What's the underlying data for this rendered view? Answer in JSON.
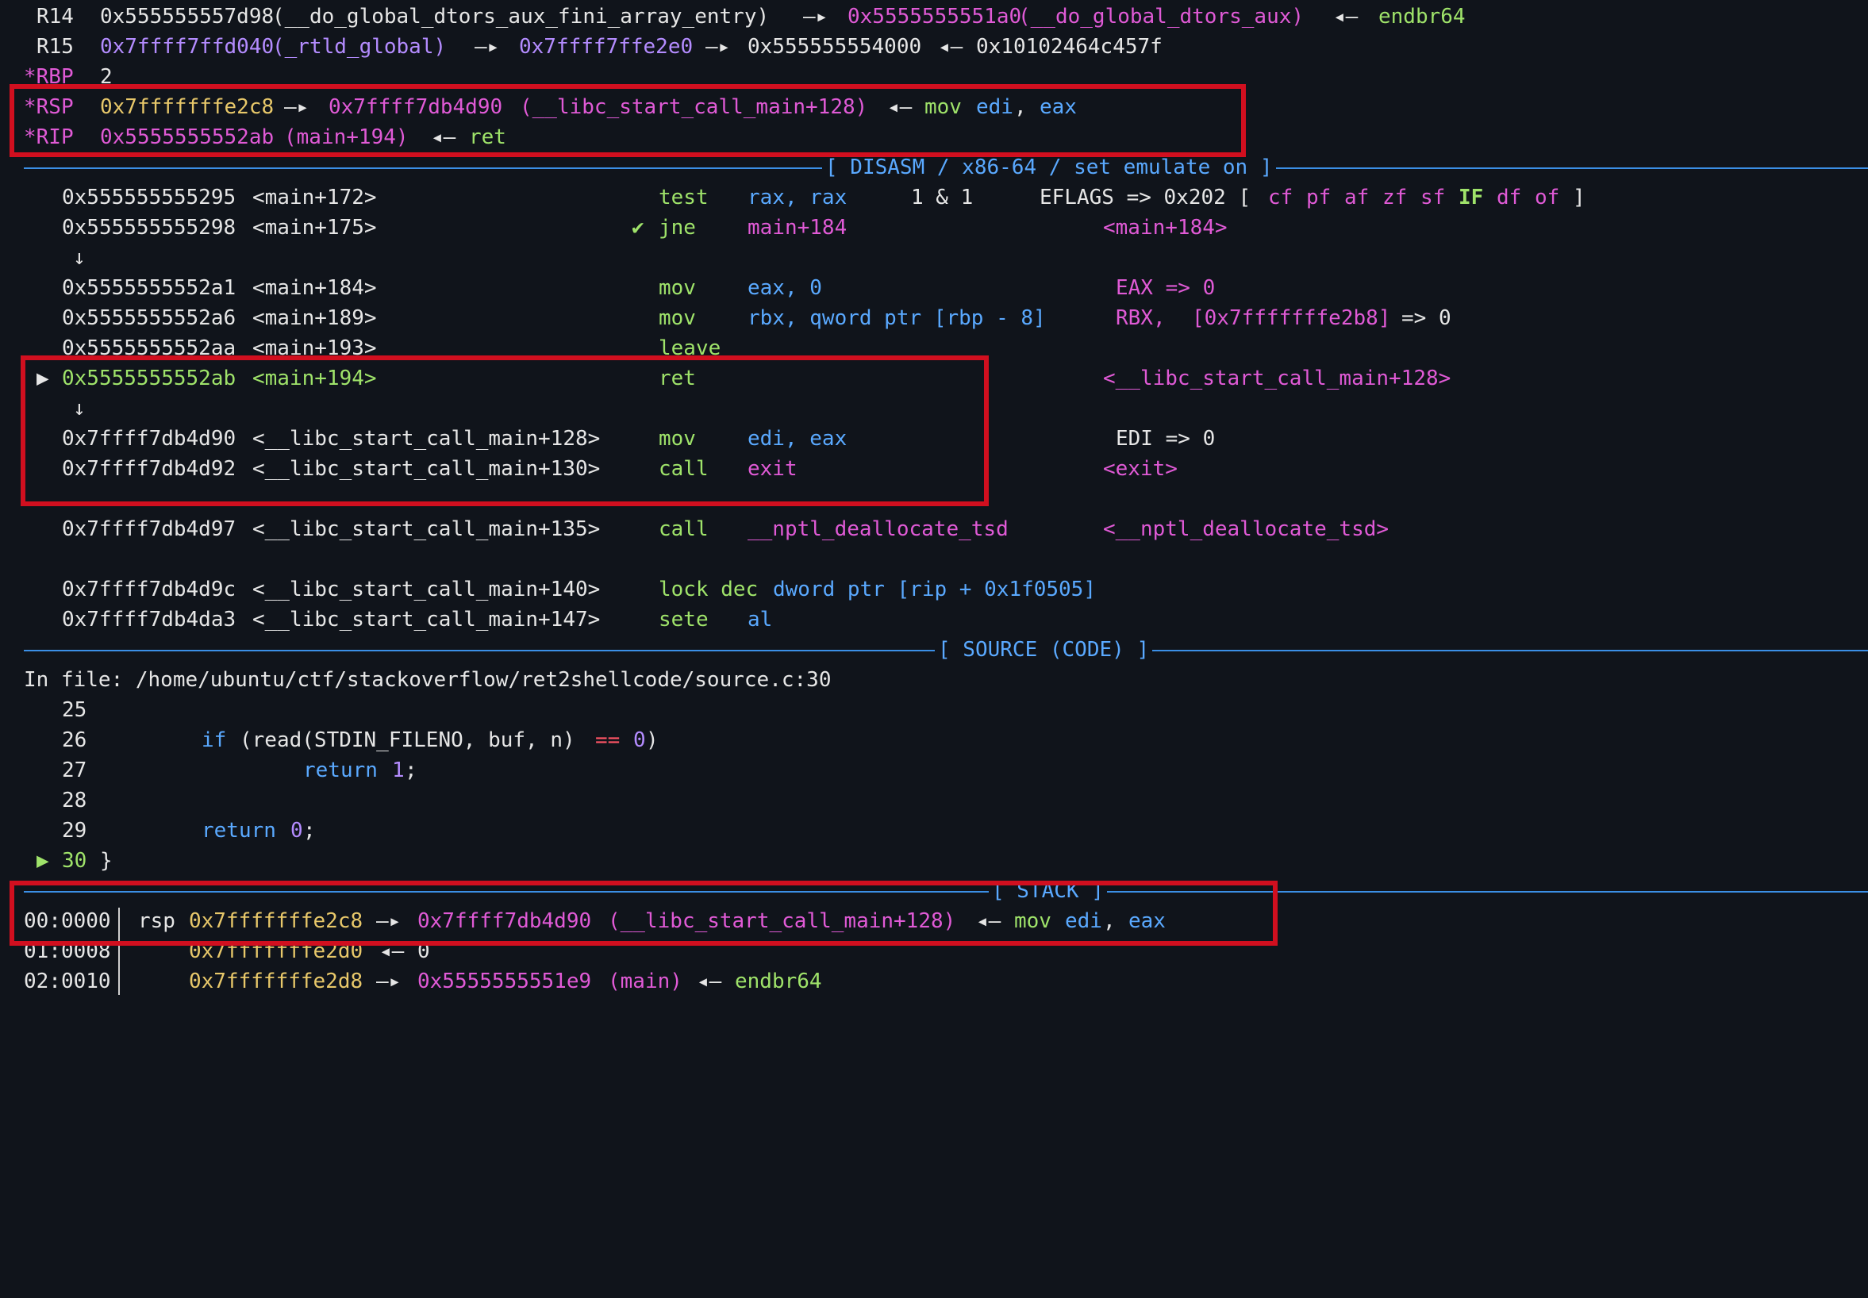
{
  "colors": {
    "background": "#10141b",
    "highlight_box": "#d10f1f",
    "separator": "#3b8fe6"
  },
  "registers": [
    {
      "name": "R14",
      "mod": false,
      "val": "0x555555557d98",
      "sym": "(__do_global_dtors_aux_fini_array_entry)",
      "arrow": "—▸",
      "ptr": "0x5555555551a0",
      "ptrsym": "(__do_global_dtors_aux)",
      "larrow": "◂—",
      "tail": "endbr64"
    },
    {
      "name": "R15",
      "mod": false,
      "val": "0x7ffff7ffd040",
      "sym": "(_rtld_global)",
      "arrow": "—▸",
      "ptr": "0x7ffff7ffe2e0",
      "arrow2": "—▸",
      "ptr2": "0x555555554000",
      "larrow": "◂—",
      "tail": "0x10102464c457f"
    },
    {
      "name": "*RBP",
      "val": "2"
    },
    {
      "name": "*RSP",
      "val": "0x7fffffffe2c8",
      "arrow": "—▸",
      "ptr": "0x7ffff7db4d90",
      "ptrsym": "(__libc_start_call_main+128)",
      "larrow": "◂—",
      "tail_op": "mov",
      "tail_a1": "edi",
      "tail_a2": "eax"
    },
    {
      "name": "*RIP",
      "val": "0x5555555552ab",
      "sym": "(main+194)",
      "larrow": "◂—",
      "tail": "ret"
    }
  ],
  "disasm": {
    "title": "[ DISASM / x86-64 / set emulate on ]",
    "rows": [
      {
        "addr": "0x555555555295",
        "sym": "<main+172>",
        "op": "test",
        "args": "rax, rax",
        "comment1": "1 & 1",
        "comment2": "EFLAGS => 0x202 [",
        "flags": [
          "cf",
          "pf",
          "af",
          "zf",
          "sf",
          "IF",
          "df",
          "of"
        ],
        "flags_close": "]"
      },
      {
        "addr": "0x555555555298",
        "sym": "<main+175>",
        "mark": "✔",
        "op": "jne",
        "args": "main+184",
        "comment": "<main+184>"
      },
      {
        "arrow": "↓"
      },
      {
        "addr": "0x5555555552a1",
        "sym": "<main+184>",
        "op": "mov",
        "args": "eax, 0",
        "comment": "EAX => 0"
      },
      {
        "addr": "0x5555555552a6",
        "sym": "<main+189>",
        "op": "mov",
        "args": "rbx, qword ptr [rbp - 8]",
        "comment_reg": "RBX,",
        "comment_addr": "[0x7fffffffe2b8]",
        "comment_val": "=> 0"
      },
      {
        "addr": "0x5555555552aa",
        "sym": "<main+193>",
        "op": "leave"
      },
      {
        "current": "▶",
        "addr": "0x5555555552ab",
        "sym": "<main+194>",
        "op": "ret",
        "comment": "<__libc_start_call_main+128>"
      },
      {
        "arrow": "↓"
      },
      {
        "addr": "0x7ffff7db4d90",
        "sym": "<__libc_start_call_main+128>",
        "op": "mov",
        "args": "edi, eax",
        "comment": "EDI => 0"
      },
      {
        "addr": "0x7ffff7db4d92",
        "sym": "<__libc_start_call_main+130>",
        "op": "call",
        "args": "exit",
        "comment": "<exit>"
      },
      {
        "addr": "0x7ffff7db4d97",
        "sym": "<__libc_start_call_main+135>",
        "op": "call",
        "args": "__nptl_deallocate_tsd",
        "comment": "<__nptl_deallocate_tsd>"
      },
      {
        "addr": "0x7ffff7db4d9c",
        "sym": "<__libc_start_call_main+140>",
        "op": "lock dec",
        "args": "dword ptr [rip + 0x1f0505]"
      },
      {
        "addr": "0x7ffff7db4da3",
        "sym": "<__libc_start_call_main+147>",
        "op": "sete",
        "args": "al"
      }
    ]
  },
  "source": {
    "title": "[ SOURCE (CODE) ]",
    "file_label": "In file: /home/ubuntu/ctf/stackoverflow/ret2shellcode/source.c:30",
    "lines": [
      {
        "no": "25",
        "code": ""
      },
      {
        "no": "26",
        "kw": "if",
        "code": "(read(STDIN_FILENO, buf, n)",
        "op": "==",
        "num": "0",
        "end": ")"
      },
      {
        "no": "27",
        "kw": "return",
        "num": "1",
        "end": ";"
      },
      {
        "no": "28",
        "code": ""
      },
      {
        "no": "29",
        "kw": "return",
        "num": "0",
        "end": ";"
      },
      {
        "no": "30",
        "current": "▶",
        "code": "}"
      }
    ]
  },
  "stack": {
    "title": "[ STACK ]",
    "rows": [
      {
        "idx": "00:0000",
        "reg": "rsp",
        "addr": "0x7fffffffe2c8",
        "arrow": "—▸",
        "ptr": "0x7ffff7db4d90",
        "ptrsym": "(__libc_start_call_main+128)",
        "larrow": "◂—",
        "op": "mov",
        "a1": "edi",
        "a2": "eax"
      },
      {
        "idx": "01:0008",
        "addr": "0x7fffffffe2d0",
        "larrow": "◂—",
        "val": "0"
      },
      {
        "idx": "02:0010",
        "addr": "0x7fffffffe2d8",
        "arrow": "—▸",
        "ptr": "0x5555555551e9",
        "ptrsym": "(main)",
        "larrow": "◂—",
        "tail": "endbr64"
      }
    ]
  }
}
